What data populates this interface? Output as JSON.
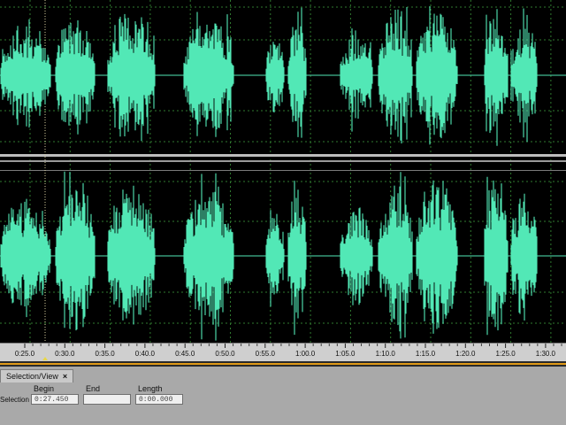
{
  "timeline": {
    "ticks": [
      "0:25.0",
      "0:30.0",
      "0:35.0",
      "0:40.0",
      "0:45.0",
      "0:50.0",
      "0:55.0",
      "1:00.0",
      "1:05.0",
      "1:10.0",
      "1:15.0",
      "1:20.0",
      "1:25.0",
      "1:30.0"
    ]
  },
  "selection_panel": {
    "tab_label": "Selection/View",
    "close_glyph": "×",
    "headers": {
      "begin": "Begin",
      "end": "End",
      "length": "Length"
    },
    "row_label": "Selection",
    "begin_value": "0:27.450",
    "end_value": "",
    "length_value": "0:00.000"
  },
  "colors": {
    "waveform": "#52e8b6",
    "background": "#000000",
    "grid": "#2f7a2f",
    "timeline_bg": "#cfcfcf",
    "accent": "#e09a18"
  },
  "icons": {
    "playhead": "playhead-marker-icon",
    "close": "close-icon"
  }
}
